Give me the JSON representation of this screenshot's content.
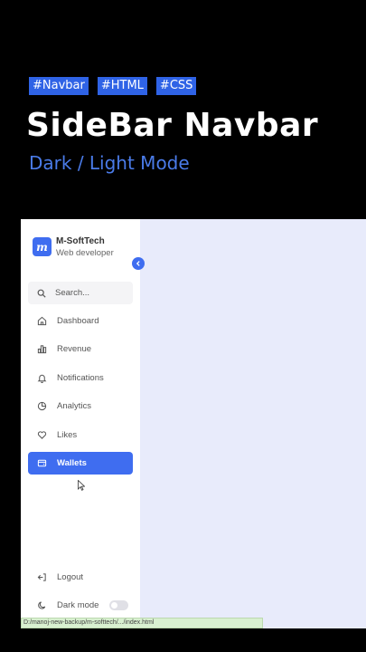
{
  "promo": {
    "tags": [
      "#Navbar",
      "#HTML",
      "#CSS"
    ],
    "title": "SideBar Navbar",
    "subtitle": "Dark / Light Mode"
  },
  "sidebar": {
    "brand": {
      "logo_letter": "m",
      "name": "M-SoftTech",
      "subtitle": "Web developer"
    },
    "toggle_icon": "chevron-left-icon",
    "search": {
      "placeholder": "Search...",
      "icon": "search-icon"
    },
    "items": [
      {
        "label": "Dashboard",
        "icon": "home-icon",
        "active": false
      },
      {
        "label": "Revenue",
        "icon": "bar-chart-icon",
        "active": false
      },
      {
        "label": "Notifications",
        "icon": "bell-icon",
        "active": false
      },
      {
        "label": "Analytics",
        "icon": "pie-chart-icon",
        "active": false
      },
      {
        "label": "Likes",
        "icon": "heart-icon",
        "active": false
      },
      {
        "label": "Wallets",
        "icon": "wallet-icon",
        "active": true
      }
    ],
    "bottom": {
      "logout": {
        "label": "Logout",
        "icon": "logout-icon"
      },
      "dark_mode": {
        "label": "Dark mode",
        "icon": "moon-icon",
        "enabled": false
      }
    }
  },
  "status_url": "D:/manoj-new-backup/m-softtech/.../index.html",
  "colors": {
    "accent": "#3f6df0",
    "main_bg": "#e8ebfb",
    "tag_bg": "#2f63e6",
    "subtitle": "#4a7be8"
  }
}
